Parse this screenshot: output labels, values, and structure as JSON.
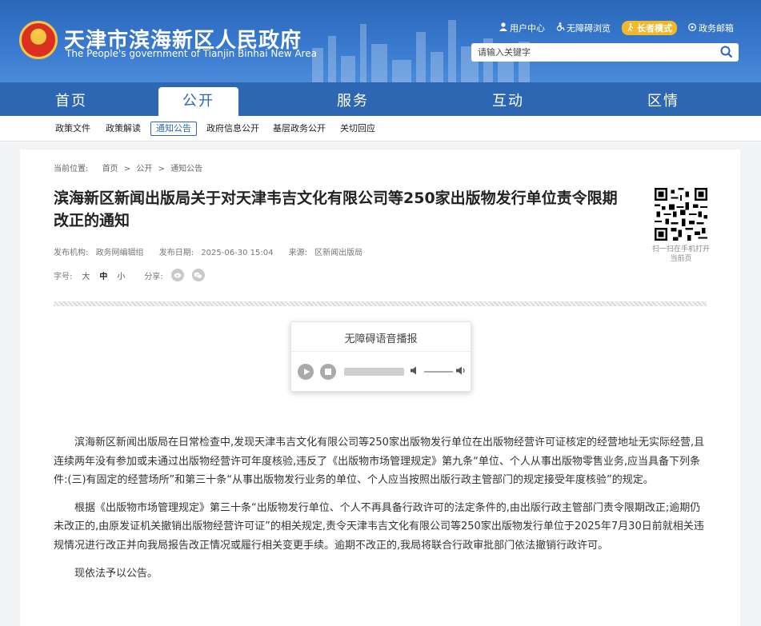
{
  "header": {
    "title": "天津市滨海新区人民政府",
    "subtitle": "The People's government of Tianjin Binhai New Area",
    "links": [
      {
        "label": "用户中心",
        "icon": "user-icon"
      },
      {
        "label": "无障碍浏览",
        "icon": "accessibility-icon"
      },
      {
        "label": "长者模式",
        "icon": "elder-icon"
      },
      {
        "label": "政务邮箱",
        "icon": "mail-icon"
      }
    ],
    "search_placeholder": "请输入关键字",
    "brand_color": "#2d66b3"
  },
  "nav": {
    "items": [
      "首页",
      "公开",
      "服务",
      "互动",
      "区情"
    ],
    "active": "公开"
  },
  "subnav": {
    "items": [
      "政策文件",
      "政策解读",
      "通知公告",
      "政府信息公开",
      "基层政务公开",
      "关切回应"
    ],
    "active": "通知公告"
  },
  "breadcrumb": {
    "label": "当前位置:",
    "items": [
      "首页",
      ">",
      "公开",
      ">",
      "通知公告"
    ]
  },
  "article": {
    "title": "滨海新区新闻出版局关于对天津韦吉文化有限公司等250家出版物发行单位责令限期改正的通知",
    "meta": {
      "org_label": "发布机构:",
      "org": "政务网编辑组",
      "date_label": "发布日期:",
      "date": "2025-06-30 15:04",
      "source_label": "来源:",
      "source": "区新闻出版局"
    },
    "font_label": "字号:",
    "font_sizes": [
      "大",
      "中",
      "小"
    ],
    "share_label": "分享:",
    "qr_text": "扫一扫在手机打开当前页",
    "player_title": "无障碍语音播报",
    "paragraphs": [
      "滨海新区新闻出版局在日常检查中,发现天津韦吉文化有限公司等250家出版物发行单位在出版物经营许可证核定的经营地址无实际经营,且连续两年没有参加或未通过出版物经营许可年度核验,违反了《出版物市场管理规定》第九条“单位、个人从事出版物零售业务,应当具备下列条件:(三)有固定的经营场所”和第三十条“从事出版物发行业务的单位、个人应当按照出版行政主管部门的规定接受年度核验”的规定。",
      "根据《出版物市场管理规定》第三十条“出版物发行单位、个人不再具备行政许可的法定条件的,由出版行政主管部门责令限期改正;逾期仍未改正的,由原发证机关撤销出版物经营许可证”的相关规定,责令天津韦吉文化有限公司等250家出版物发行单位于2025年7月30日前就相关违规情况进行改正并向我局报告改正情况或履行相关变更手续。逾期不改正的,我局将联合行政审批部门依法撤销行政许可。",
      "现依法予以公告。"
    ]
  }
}
